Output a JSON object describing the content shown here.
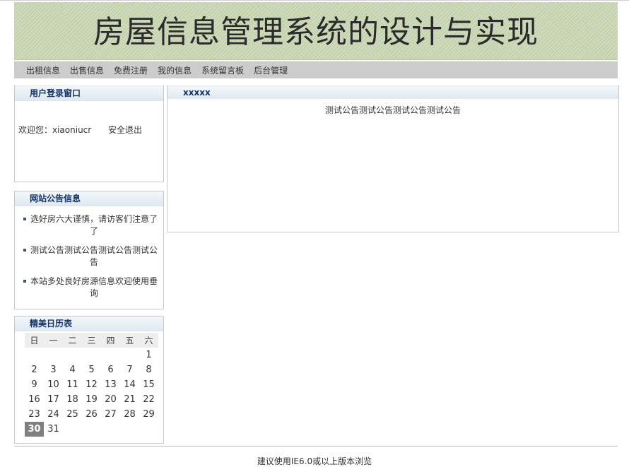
{
  "banner": {
    "title": "房屋信息管理系统的设计与实现"
  },
  "nav": {
    "items": [
      {
        "label": "出租信息"
      },
      {
        "label": "出售信息"
      },
      {
        "label": "免费注册"
      },
      {
        "label": "我的信息"
      },
      {
        "label": "系统留言板"
      },
      {
        "label": "后台管理"
      }
    ]
  },
  "login": {
    "title": "用户登录窗口",
    "welcome": "欢迎您：xiaoniucr",
    "logout": "安全退出"
  },
  "notices": {
    "title": "网站公告信息",
    "items": [
      {
        "text": "选好房六大谨慎，请访客们注意了了"
      },
      {
        "text": "测试公告测试公告测试公告测试公告"
      },
      {
        "text": "本站多处良好房源信息欢迎使用垂询"
      }
    ]
  },
  "calendar": {
    "title": "精美日历表",
    "weekdays": [
      "日",
      "一",
      "二",
      "三",
      "四",
      "五",
      "六"
    ],
    "weeks": [
      [
        "",
        "",
        "",
        "",
        "",
        "",
        "1"
      ],
      [
        "2",
        "3",
        "4",
        "5",
        "6",
        "7",
        "8"
      ],
      [
        "9",
        "10",
        "11",
        "12",
        "13",
        "14",
        "15"
      ],
      [
        "16",
        "17",
        "18",
        "19",
        "20",
        "21",
        "22"
      ],
      [
        "23",
        "24",
        "25",
        "26",
        "27",
        "28",
        "29"
      ],
      [
        "30",
        "31",
        "",
        "",
        "",
        "",
        ""
      ]
    ],
    "today": "30"
  },
  "main": {
    "title": "xxxxx",
    "notice": "测试公告测试公告测试公告测试公告"
  },
  "footer": {
    "text": "建议使用IE6.0或以上版本浏览"
  }
}
